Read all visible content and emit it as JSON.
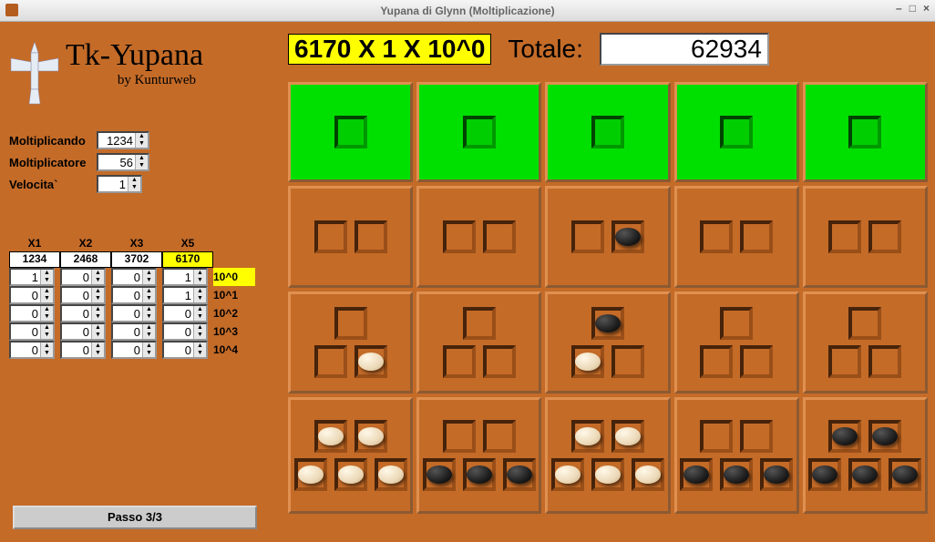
{
  "window": {
    "title": "Yupana di Glynn (Moltiplicazione)"
  },
  "logo": {
    "title": "Tk-Yupana",
    "subtitle": "by Kunturweb"
  },
  "params": {
    "moltiplicando_label": "Moltiplicando",
    "moltiplicando_value": "1234",
    "moltiplicatore_label": "Moltiplicatore",
    "moltiplicatore_value": "56",
    "velocita_label": "Velocita`",
    "velocita_value": "1"
  },
  "matrix": {
    "col_headers": [
      "X1",
      "X2",
      "X3",
      "X5"
    ],
    "head_values": [
      "1234",
      "2468",
      "3702",
      "6170"
    ],
    "head_highlight_index": 3,
    "rows": [
      {
        "values": [
          "1",
          "0",
          "0",
          "1"
        ],
        "label": "10^0",
        "highlight": true
      },
      {
        "values": [
          "0",
          "0",
          "0",
          "1"
        ],
        "label": "10^1",
        "highlight": false
      },
      {
        "values": [
          "0",
          "0",
          "0",
          "0"
        ],
        "label": "10^2",
        "highlight": false
      },
      {
        "values": [
          "0",
          "0",
          "0",
          "0"
        ],
        "label": "10^3",
        "highlight": false
      },
      {
        "values": [
          "0",
          "0",
          "0",
          "0"
        ],
        "label": "10^4",
        "highlight": false
      }
    ]
  },
  "passo_button": "Passo 3/3",
  "header": {
    "expression": "6170 X 1 X 10^0",
    "totale_label": "Totale:",
    "totale_value": "62934"
  },
  "board": {
    "rows": [
      {
        "green": true,
        "cells": [
          {
            "pattern": "1",
            "beans": [
              null
            ]
          },
          {
            "pattern": "1",
            "beans": [
              null
            ]
          },
          {
            "pattern": "1",
            "beans": [
              null
            ]
          },
          {
            "pattern": "1",
            "beans": [
              null
            ]
          },
          {
            "pattern": "1",
            "beans": [
              null
            ]
          }
        ]
      },
      {
        "green": false,
        "cells": [
          {
            "pattern": "2",
            "beans": [
              null,
              null
            ]
          },
          {
            "pattern": "2",
            "beans": [
              null,
              null
            ]
          },
          {
            "pattern": "2",
            "beans": [
              null,
              "black"
            ]
          },
          {
            "pattern": "2",
            "beans": [
              null,
              null
            ]
          },
          {
            "pattern": "2",
            "beans": [
              null,
              null
            ]
          }
        ]
      },
      {
        "green": false,
        "cells": [
          {
            "pattern": "1+2",
            "beans": [
              null,
              null,
              "white"
            ]
          },
          {
            "pattern": "1+2",
            "beans": [
              null,
              null,
              null
            ]
          },
          {
            "pattern": "1+2",
            "beans": [
              "black",
              "white",
              null
            ]
          },
          {
            "pattern": "1+2",
            "beans": [
              null,
              null,
              null
            ]
          },
          {
            "pattern": "1+2",
            "beans": [
              null,
              null,
              null
            ]
          }
        ]
      },
      {
        "green": false,
        "cells": [
          {
            "pattern": "2+3",
            "beans": [
              "white",
              "white",
              "white",
              "white",
              "white"
            ]
          },
          {
            "pattern": "2+3",
            "beans": [
              null,
              null,
              "black",
              "black",
              "black"
            ]
          },
          {
            "pattern": "2+3",
            "beans": [
              "white",
              "white",
              "white",
              "white",
              "white"
            ]
          },
          {
            "pattern": "2+3",
            "beans": [
              null,
              null,
              "black",
              "black",
              "black"
            ]
          },
          {
            "pattern": "2+3",
            "beans": [
              "black",
              "black",
              "black",
              "black",
              "black"
            ]
          }
        ]
      }
    ]
  }
}
